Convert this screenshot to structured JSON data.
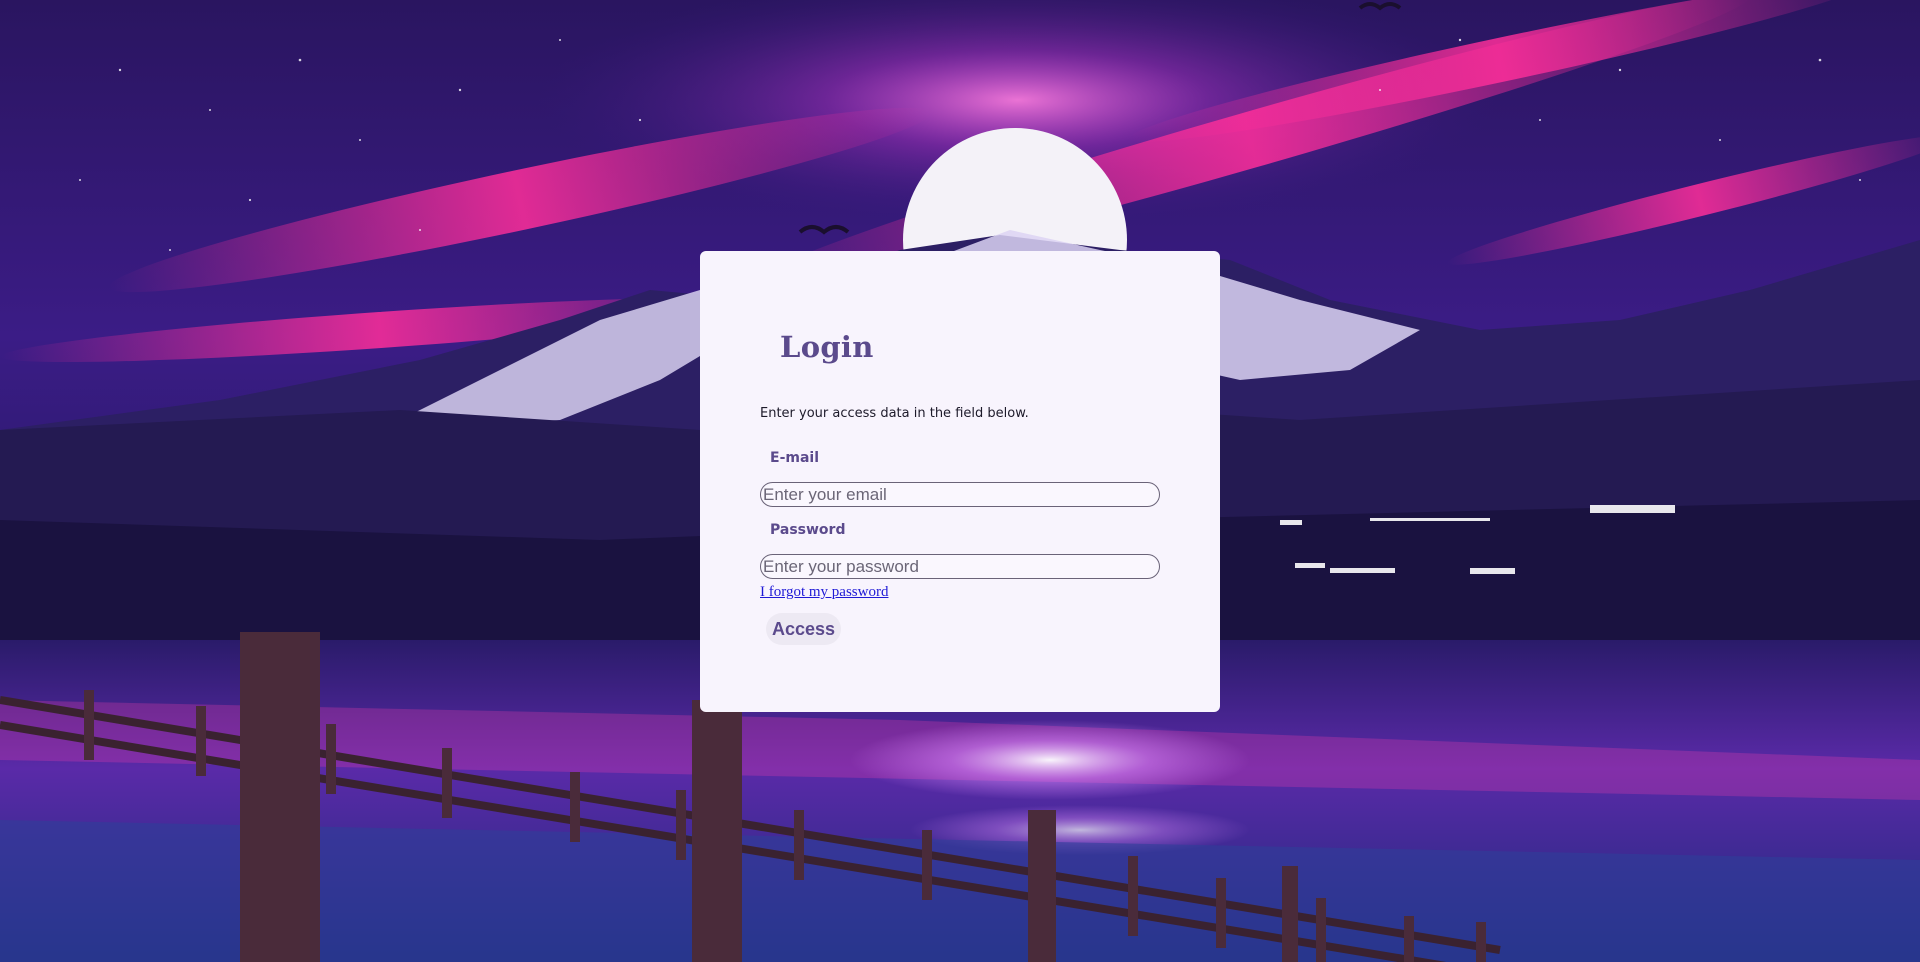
{
  "login": {
    "title": "Login",
    "subtitle": "Enter your access data in the field below.",
    "email_label": "E-mail",
    "email_placeholder": "Enter your email",
    "email_value": "",
    "password_label": "Password",
    "password_placeholder": "Enter your password",
    "password_value": "",
    "forgot_link": "I forgot my password",
    "access_button": "Access"
  },
  "colors": {
    "card_background": "#f8f4fd",
    "accent_purple": "#5b4a8c",
    "link_blue": "#1f1ad6",
    "button_background": "#ede9f3"
  },
  "background": {
    "icon": "night-landscape-image"
  }
}
